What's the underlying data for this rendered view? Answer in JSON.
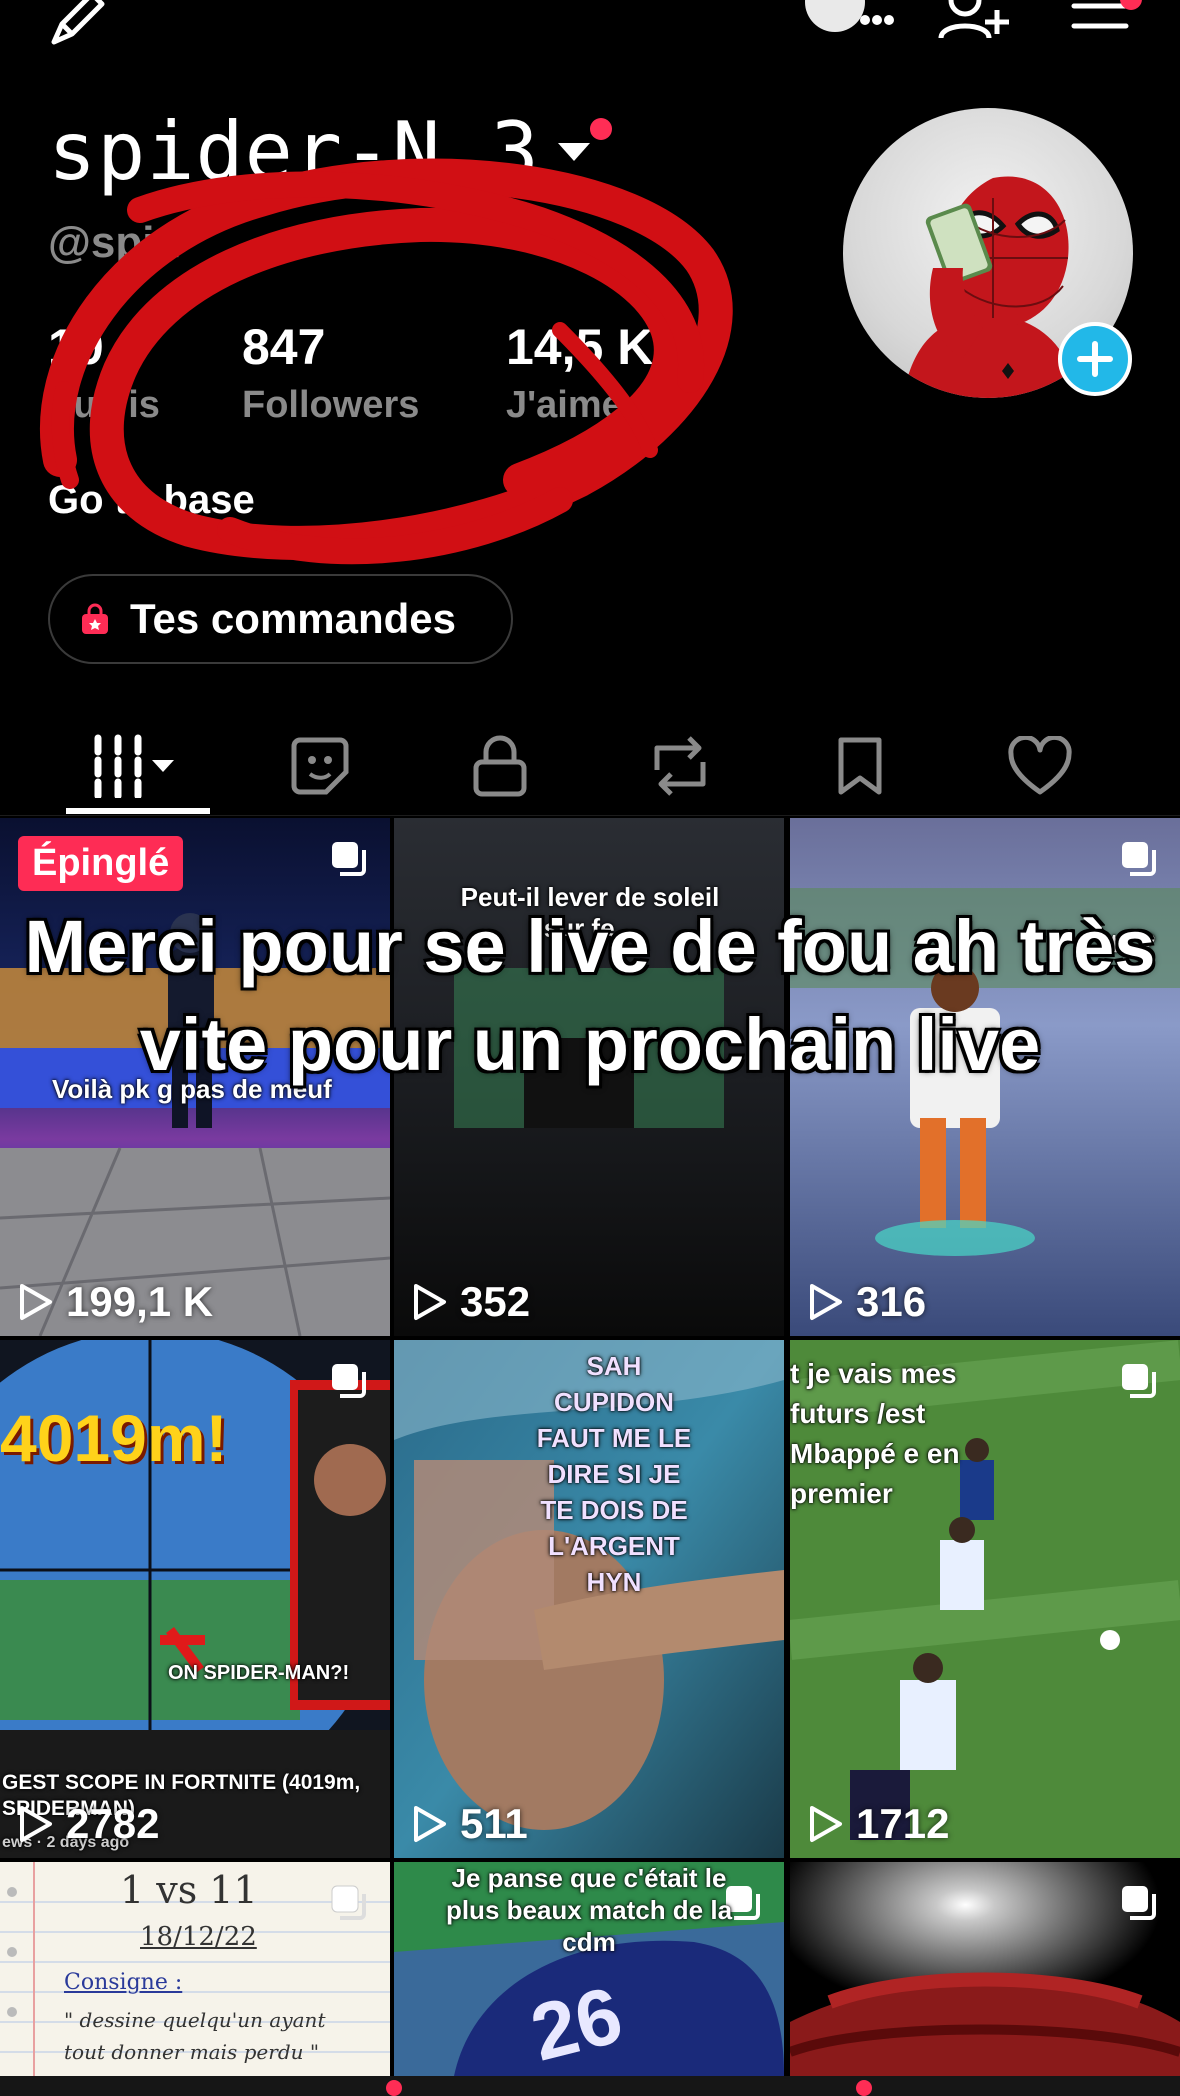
{
  "profile": {
    "username": "spider-N.3",
    "handle": "@spid",
    "bio": "Go to base",
    "orders_label": "Tes commandes"
  },
  "stats": [
    {
      "value": "19",
      "label": "Suivis"
    },
    {
      "value": "847",
      "label": "Followers"
    },
    {
      "value": "14,5 K",
      "label": "J'aime"
    }
  ],
  "tabs": [
    {
      "icon": "grid-icon",
      "selected": true
    },
    {
      "icon": "sticker-icon"
    },
    {
      "icon": "lock-icon"
    },
    {
      "icon": "repost-icon"
    },
    {
      "icon": "bookmark-icon"
    },
    {
      "icon": "heart-icon"
    }
  ],
  "overlay_caption": "Merci pour se live de fou ah très vite pour un prochain live",
  "videos": [
    {
      "views": "199,1 K",
      "pinned_label": "Épinglé",
      "caption": "Voilà pk g pas de meuf"
    },
    {
      "views": "352",
      "caption": "Peut-il lever de soleil sur fe..."
    },
    {
      "views": "316",
      "caption": "...te ?"
    },
    {
      "views": "2782",
      "caption": "4019m!",
      "caption2": "ON SPIDER-MAN?!",
      "caption3": "GEST SCOPE IN FORTNITE (4019m, SPIDERMAN)",
      "caption4": "ews · 2 days ago"
    },
    {
      "views": "511",
      "caption": "SAH CUPIDON FAUT ME LE DIRE SI JE TE DOIS DE L'ARGENT HYN"
    },
    {
      "views": "1712",
      "caption": "t je vais mes futurs /est Mbappé e en premier"
    },
    {
      "views": "",
      "caption": "1 vs 11",
      "caption2": "18/12/22",
      "caption3": "Consigne :",
      "caption4": "\" dessine quelqu'un ayant tout donner mais perdu \""
    },
    {
      "views": "",
      "caption": "Je panse que c'était le plus beaux match de la cdm"
    },
    {
      "views": ""
    }
  ],
  "colors": {
    "accent": "#fe2c55",
    "plus_badge": "#22b8e8",
    "secondary_text": "#8a8a8a",
    "scribble": "#d10f14"
  }
}
